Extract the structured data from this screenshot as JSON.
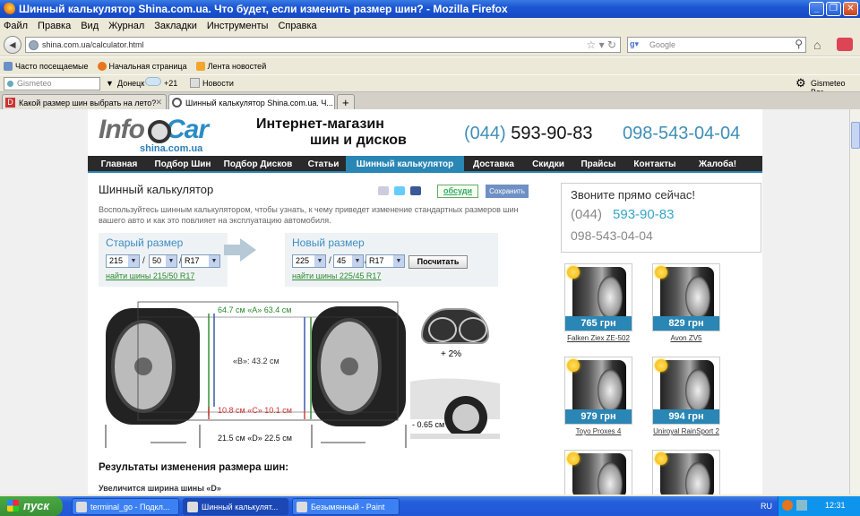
{
  "window": {
    "title": "Шинный калькулятор Shina.com.ua. Что будет, если изменить размер шин? - Mozilla Firefox"
  },
  "menu": [
    "Файл",
    "Правка",
    "Вид",
    "Журнал",
    "Закладки",
    "Инструменты",
    "Справка"
  ],
  "url": {
    "value": "shina.com.ua/calculator.html"
  },
  "search": {
    "placeholder": "Google"
  },
  "bookmarks": [
    "Часто посещаемые",
    "Начальная страница",
    "Лента новостей"
  ],
  "gismeteo": {
    "input": "Gismeteo",
    "city": "Донецк",
    "temp": "+21",
    "news": "Новости",
    "bar": "Gismeteo Bar"
  },
  "tabs": [
    {
      "label": "Какой размер шин выбрать на лето?"
    },
    {
      "label": "Шинный калькулятор Shina.com.ua. Ч..."
    }
  ],
  "site": {
    "logo_info": "Info",
    "logo_car": "Car",
    "logo_domain": "shina.com.ua",
    "slogan1": "Интернет-магазин",
    "slogan2": "шин и дисков",
    "phone1_code": "(044)",
    "phone1_num": "593-90-83",
    "phone2": "098-543-04-04"
  },
  "nav": [
    "Главная",
    "Подбор Шин",
    "Подбор Дисков",
    "Статьи",
    "Шинный калькулятор",
    "Доставка",
    "Скидки",
    "Прайсы",
    "Контакты",
    "Жалоба!"
  ],
  "calc": {
    "title": "Шинный калькулятор",
    "discuss": "обсуди",
    "save": "Сохранить",
    "desc": "Воспользуйтесь шинным калькулятором, чтобы узнать, к чему приведет изменение стандартных размеров шин вашего авто и как это повлияет на эксплуатацию автомобиля.",
    "old_label": "Старый размер",
    "old_w": "215",
    "old_p": "50",
    "old_r": "R17",
    "old_link": "найти шины 215/50 R17",
    "new_label": "Новый размер",
    "new_w": "225",
    "new_p": "45",
    "new_r": "R17",
    "new_link": "найти шины 225/45 R17",
    "calc_btn": "Посчитать"
  },
  "diagram": {
    "A": "64.7 см «A» 63.4 см",
    "B": "«B»: 43.2 см",
    "C": "10.8 см «C» 10.1 см",
    "D": "21.5 см «D» 22.5 см",
    "speed": "+ 2%",
    "clearance": "- 0.65 см"
  },
  "results": {
    "title": "Результаты изменения размера шин:",
    "line1": "Увеличится ширина шины «D»"
  },
  "call": {
    "title": "Звоните прямо сейчас!",
    "code": "(044)",
    "num": "593-90-83",
    "mobile": "098-543-04-04"
  },
  "products": [
    {
      "price": "765 грн",
      "name": "Falken Ziex ZE-502"
    },
    {
      "price": "829 грн",
      "name": "Avon ZV5"
    },
    {
      "price": "979 грн",
      "name": "Toyo Proxes 4"
    },
    {
      "price": "994 грн",
      "name": "Uniroyal RainSport 2"
    }
  ],
  "taskbar": {
    "start": "пуск",
    "tasks": [
      "terminal_go - Подкл...",
      "Шинный калькулят...",
      "Безымянный - Paint"
    ],
    "lang": "RU",
    "time": "12:31"
  },
  "colors": {
    "accent": "#2a86b4",
    "green_link": "#2e8a2e",
    "nav_bg": "#2a2a2a"
  }
}
